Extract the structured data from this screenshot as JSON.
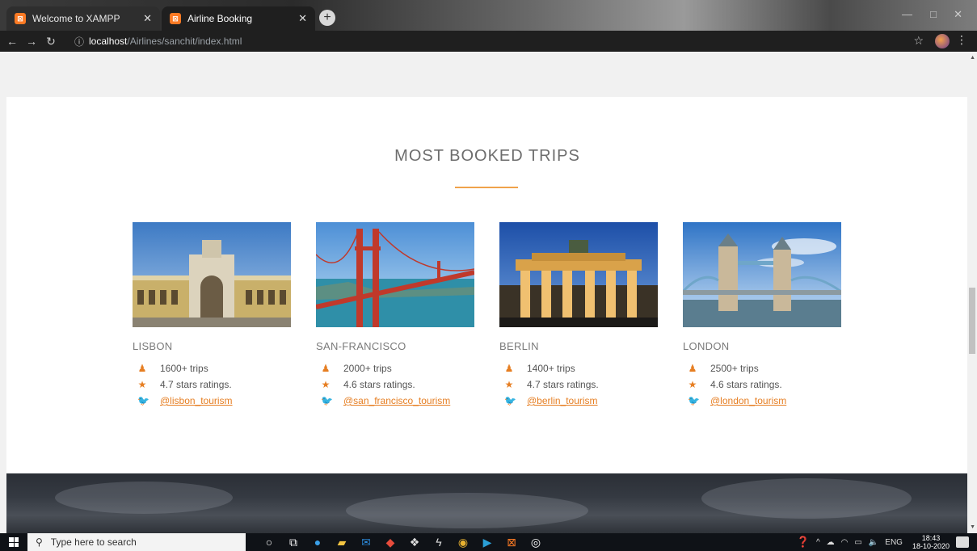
{
  "browser": {
    "tabs": [
      {
        "title": "Welcome to XAMPP",
        "active": false
      },
      {
        "title": "Airline Booking",
        "active": true
      }
    ],
    "url_host": "localhost",
    "url_path": "/Airlines/sanchit/index.html"
  },
  "section": {
    "title": "MOST BOOKED TRIPS",
    "cards": [
      {
        "city": "LISBON",
        "trips": "1600+ trips",
        "rating": "4.7 stars ratings.",
        "handle": "@lisbon_tourism"
      },
      {
        "city": "SAN-FRANCISCO",
        "trips": "2000+ trips",
        "rating": "4.6 stars ratings.",
        "handle": "@san_francisco_tourism"
      },
      {
        "city": "BERLIN",
        "trips": "1400+ trips",
        "rating": "4.7 stars ratings.",
        "handle": "@berlin_tourism"
      },
      {
        "city": "LONDON",
        "trips": "2500+ trips",
        "rating": "4.6 stars ratings.",
        "handle": "@london_tourism"
      }
    ]
  },
  "taskbar": {
    "search_placeholder": "Type here to search",
    "language": "ENG",
    "time": "18:43",
    "date": "18-10-2020"
  },
  "colors": {
    "accent": "#e67e22",
    "rule": "#f0a24b"
  }
}
